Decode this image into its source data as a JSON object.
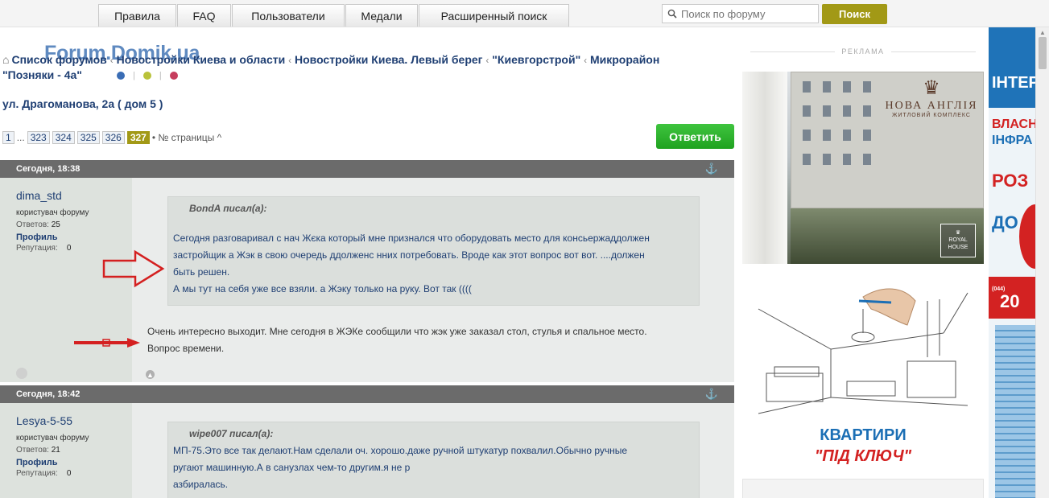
{
  "nav": {
    "tabs": [
      "Правила",
      "FAQ",
      "Пользователи",
      "Медали",
      "Расширенный поиск"
    ]
  },
  "search": {
    "placeholder": "Поиск по форуму",
    "button": "Поиск"
  },
  "logo": "Forum.Domik.ua",
  "breadcrumb": {
    "items": [
      "Список форумов",
      "Новостройки Киева и области",
      "Новостройки Киева. Левый берег",
      "\"Киевгорстрой\"",
      "Микрорайон \"Позняки - 4а\""
    ],
    "separator": "‹"
  },
  "topic": {
    "title": "ул. Драгоманова, 2а ( дом 5 )"
  },
  "pagination": {
    "first": "1",
    "ellipsis": "...",
    "pages": [
      "323",
      "324",
      "325",
      "326"
    ],
    "current": "327",
    "label": "• № страницы ^"
  },
  "reply_button": "Ответить",
  "posts": [
    {
      "time": "Сегодня, 18:38",
      "author": "dima_std",
      "role": "користувач форуму",
      "answers_label": "Ответов:",
      "answers": "25",
      "profile": "Профиль",
      "reputation_label": "Репутация:",
      "reputation": "0",
      "quote_author": "BondA писал(а):",
      "quote_lines": [
        "Сегодня разговаривал с нач Жєка который мне признался что оборудовать место для консьержаддолжен",
        "застройщик а Жэк в свою очередь ддолженс нних потребовать. Вроде как этот вопрос вот вот. ....должен",
        "быть решен.",
        "А мы тут на себя уже все взяли. а Жэку только на руку. Вот так (((("
      ],
      "text_lines": [
        "Очень интересно выходит. Мне сегодня в ЖЭКе сообщили что жэк уже заказал стол, стулья и спальное место.",
        "Вопрос времени."
      ]
    },
    {
      "time": "Сегодня, 18:42",
      "author": "Lesya-5-55",
      "role": "користувач форуму",
      "answers_label": "Ответов:",
      "answers": "21",
      "profile": "Профиль",
      "reputation_label": "Репутация:",
      "reputation": "0",
      "quote_author": "wipe007 писал(а):",
      "quote_lines": [
        "МП-75.Это все так делают.Нам сделали оч. хорошо.даже ручной штукатур похвалил.Обычно ручные",
        "ругают машинную.А в санузлах чем-то другим.я не р",
        "азбиралась."
      ]
    }
  ],
  "sidebar": {
    "ad_label": "РЕКЛАМА",
    "ad1": {
      "name": "НОВА АНГЛІЯ",
      "sub": "ЖИТЛОВИЙ КОМПЛЕКС",
      "badge_line1": "ROYAL",
      "badge_line2": "HOUSE"
    },
    "ad2": {
      "title": "КВАРТИРИ",
      "subtitle": "\"ПІД КЛЮЧ\""
    }
  },
  "right_ad": {
    "lines": [
      "ІНТЕР",
      "ВЛАСН",
      "ІНФРА",
      "РОЗ",
      "ДО",
      "(044)",
      "20"
    ]
  },
  "colors": {
    "accent": "#a29916",
    "reply": "#22a822",
    "link": "#1f3f73",
    "dot_blue": "#3a6db5",
    "dot_green": "#b9c23a",
    "dot_red": "#c63d5d",
    "arrow_red": "#d42020"
  }
}
